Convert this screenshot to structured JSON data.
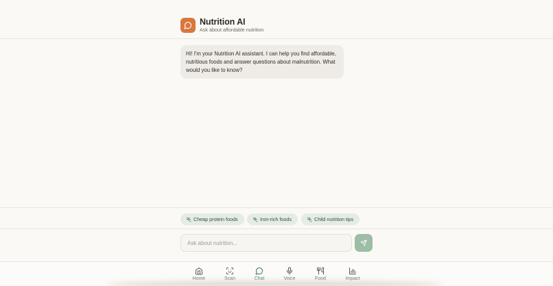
{
  "header": {
    "title": "Nutrition AI",
    "subtitle": "Ask about affordable nutrition",
    "logo_icon": "message-circle-icon"
  },
  "chat": {
    "messages": [
      {
        "role": "assistant",
        "text": "Hi! I'm your Nutrition AI assistant. I can help you find affordable, nutritious foods and answer questions about malnutrition. What would you like to know?"
      }
    ]
  },
  "suggestions": [
    {
      "label": "Cheap protein foods",
      "icon": "sparkles-icon"
    },
    {
      "label": "Iron-rich foods",
      "icon": "sparkles-icon"
    },
    {
      "label": "Child nutrition tips",
      "icon": "sparkles-icon"
    }
  ],
  "composer": {
    "placeholder": "Ask about nutrition...",
    "value": "",
    "send_icon": "send-icon"
  },
  "nav": {
    "active": "Chat",
    "items": [
      {
        "label": "Home",
        "icon": "home-icon"
      },
      {
        "label": "Scan",
        "icon": "scan-icon"
      },
      {
        "label": "Chat",
        "icon": "message-circle-icon"
      },
      {
        "label": "Voice",
        "icon": "mic-icon"
      },
      {
        "label": "Food",
        "icon": "utensils-icon"
      },
      {
        "label": "Impact",
        "icon": "bar-chart-icon"
      }
    ]
  },
  "colors": {
    "accent": "#d9773f",
    "primary_green": "#4e7b5e",
    "send_button": "#9dbda5",
    "chip_bg": "#e5ebe5",
    "background": "#faf9f6"
  }
}
